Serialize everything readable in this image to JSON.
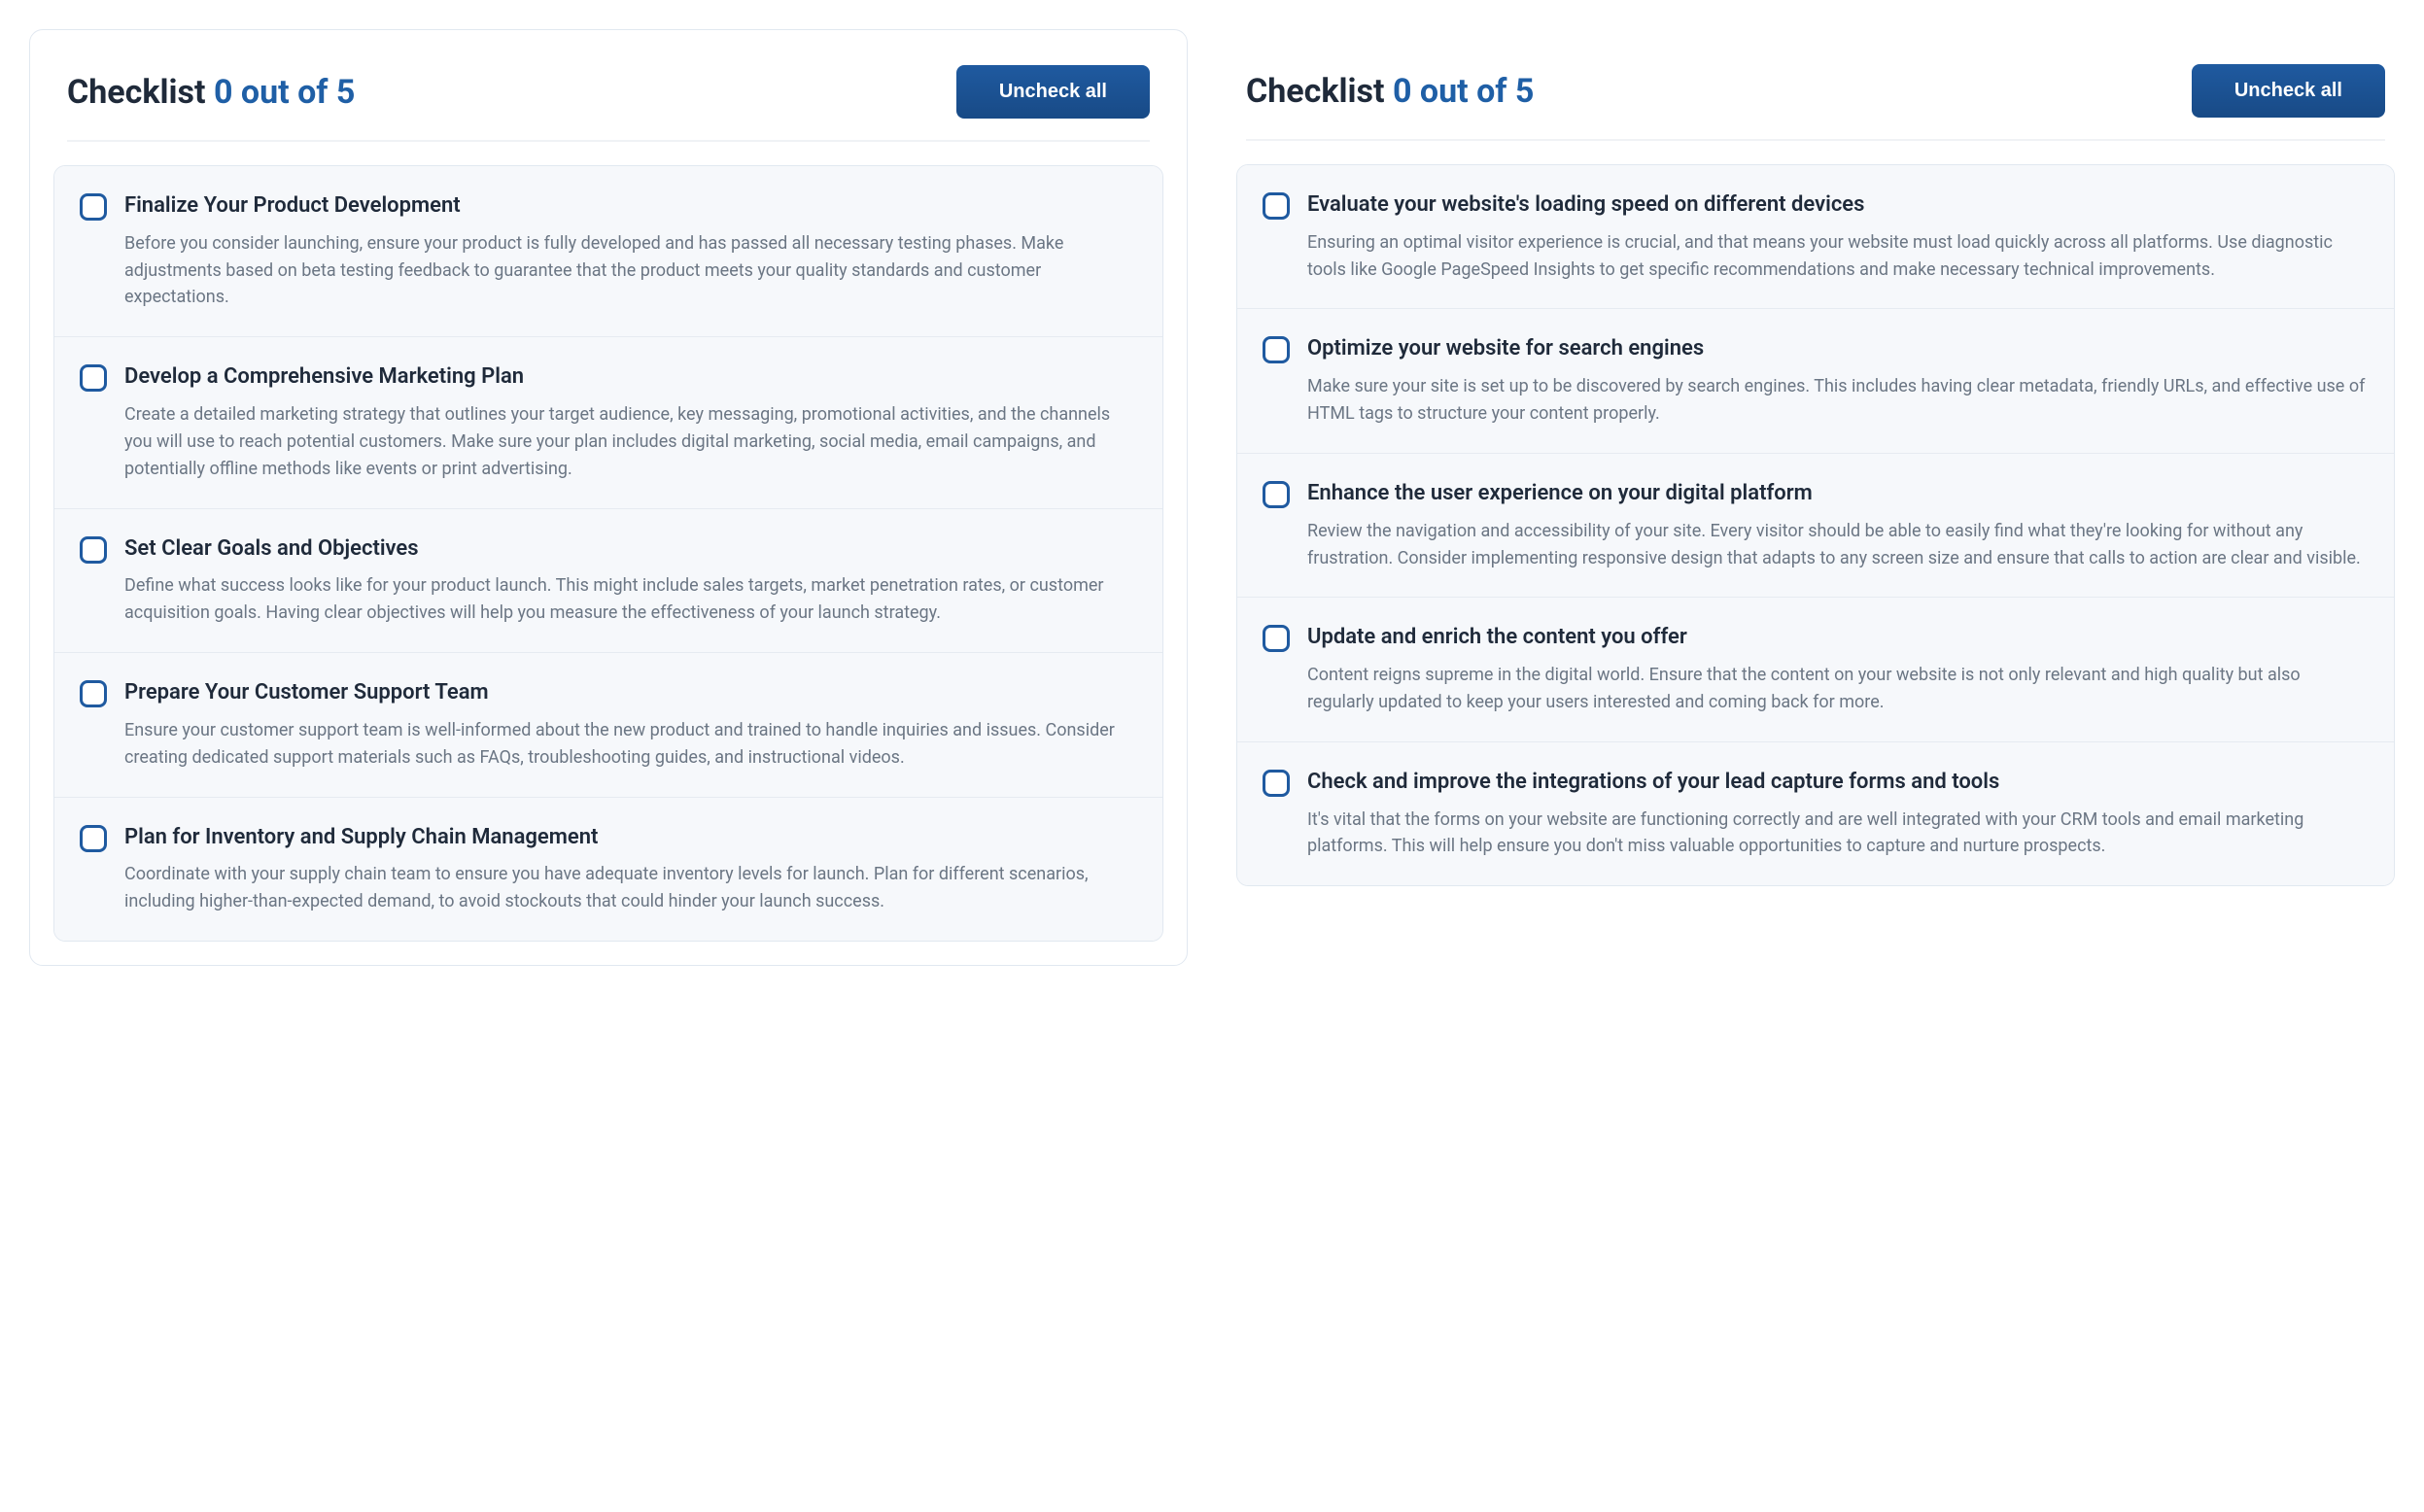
{
  "left": {
    "title_prefix": "Checklist ",
    "title_count": "0 out of 5",
    "uncheck_label": "Uncheck all",
    "items": [
      {
        "title": "Finalize Your Product Development",
        "desc": "Before you consider launching, ensure your product is fully developed and has passed all necessary testing phases. Make adjustments based on beta testing feedback to guarantee that the product meets your quality standards and customer expectations."
      },
      {
        "title": "Develop a Comprehensive Marketing Plan",
        "desc": "Create a detailed marketing strategy that outlines your target audience, key messaging, promotional activities, and the channels you will use to reach potential customers. Make sure your plan includes digital marketing, social media, email campaigns, and potentially offline methods like events or print advertising."
      },
      {
        "title": "Set Clear Goals and Objectives",
        "desc": "Define what success looks like for your product launch. This might include sales targets, market penetration rates, or customer acquisition goals. Having clear objectives will help you measure the effectiveness of your launch strategy."
      },
      {
        "title": "Prepare Your Customer Support Team",
        "desc": "Ensure your customer support team is well-informed about the new product and trained to handle inquiries and issues. Consider creating dedicated support materials such as FAQs, troubleshooting guides, and instructional videos."
      },
      {
        "title": "Plan for Inventory and Supply Chain Management",
        "desc": "Coordinate with your supply chain team to ensure you have adequate inventory levels for launch. Plan for different scenarios, including higher-than-expected demand, to avoid stockouts that could hinder your launch success."
      }
    ]
  },
  "right": {
    "title_prefix": "Checklist ",
    "title_count": "0 out of 5",
    "uncheck_label": "Uncheck all",
    "items": [
      {
        "title": "Evaluate your website's loading speed on different devices",
        "desc": "Ensuring an optimal visitor experience is crucial, and that means your website must load quickly across all platforms. Use diagnostic tools like Google PageSpeed Insights to get specific recommendations and make necessary technical improvements."
      },
      {
        "title": "Optimize your website for search engines",
        "desc": "Make sure your site is set up to be discovered by search engines. This includes having clear metadata, friendly URLs, and effective use of HTML tags to structure your content properly."
      },
      {
        "title": "Enhance the user experience on your digital platform",
        "desc": "Review the navigation and accessibility of your site. Every visitor should be able to easily find what they're looking for without any frustration. Consider implementing responsive design that adapts to any screen size and ensure that calls to action are clear and visible."
      },
      {
        "title": "Update and enrich the content you offer",
        "desc": "Content reigns supreme in the digital world. Ensure that the content on your website is not only relevant and high quality but also regularly updated to keep your users interested and coming back for more."
      },
      {
        "title": "Check and improve the integrations of your lead capture forms and tools",
        "desc": "It's vital that the forms on your website are functioning correctly and are well integrated with your CRM tools and email marketing platforms. This will help ensure you don't miss valuable opportunities to capture and nurture prospects."
      }
    ]
  }
}
